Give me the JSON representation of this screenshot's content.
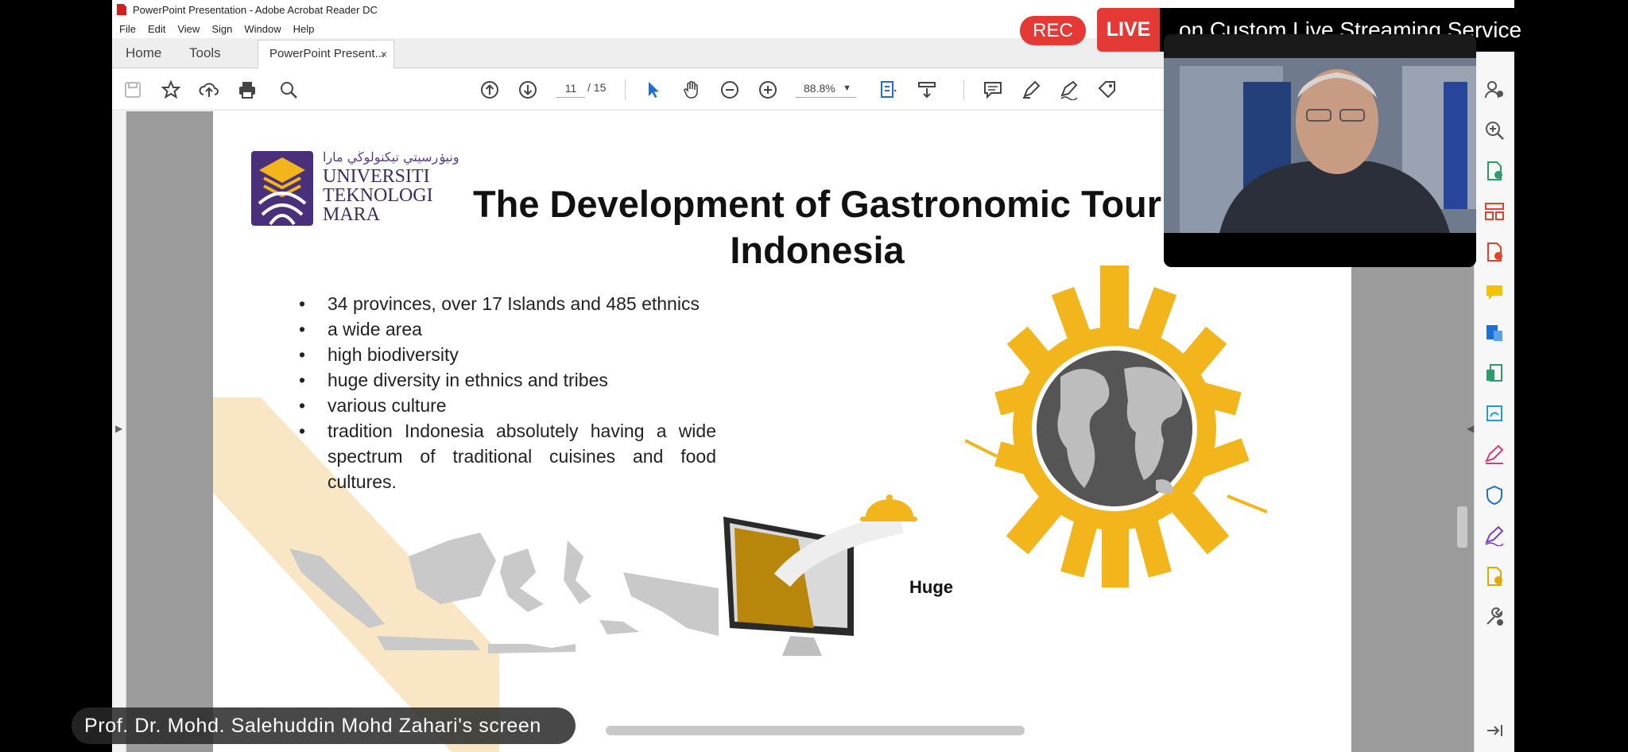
{
  "window": {
    "title": "PowerPoint Presentation - Adobe Acrobat Reader DC"
  },
  "menu": {
    "items": [
      "File",
      "Edit",
      "View",
      "Sign",
      "Window",
      "Help"
    ]
  },
  "tabs": {
    "home": "Home",
    "tools": "Tools",
    "document": "PowerPoint Present...",
    "close": "×"
  },
  "toolbar": {
    "page_current": "11",
    "page_total": "/ 15",
    "zoom": "88.8%",
    "icons": [
      "save-icon",
      "bookmark-star-icon",
      "upload-cloud-icon",
      "print-icon",
      "search-icon",
      "prev-page-icon",
      "next-page-icon",
      "select-cursor-icon",
      "hand-icon",
      "zoom-out-icon",
      "zoom-in-icon",
      "page-fit-icon",
      "scroll-mode-icon",
      "comment-icon",
      "highlight-pen-icon",
      "sign-icon",
      "fill-sign-icon"
    ]
  },
  "right_panel": {
    "icons": [
      "share-user-icon",
      "zoom-icon",
      "export-pdf-icon",
      "organize-pages-icon",
      "create-pdf-icon",
      "comment-icon",
      "edit-pdf-icon",
      "compress-icon",
      "send-sign-icon",
      "fill-sign-icon",
      "protect-icon",
      "sign-pen-icon",
      "more-tools-icon",
      "customize-tools-icon",
      "collapse-panel-icon"
    ],
    "accent": "#e8402b"
  },
  "slide": {
    "logo": {
      "script": "ونيۏرسيتي تيكنولوڬي مارا",
      "line1": "UNIVERSITI",
      "line2": "TEKNOLOGI",
      "line3": "MARA"
    },
    "title_line1": "The Development of Gastronomic Tour",
    "title_line2": "Indonesia",
    "bullets": [
      "34 provinces, over 17 Islands and 485 ethnics",
      "a wide area",
      "high biodiversity",
      "huge diversity in ethnics and tribes",
      "various culture",
      "tradition Indonesia absolutely having a wide spectrum of traditional cuisines and food cultures."
    ],
    "illustration_label": "Huge",
    "colors": {
      "gold": "#f2b51b",
      "globe": "#555555",
      "map": "#c9c9c9",
      "logo_purple": "#4a2f7a"
    }
  },
  "overlay": {
    "rec": "REC",
    "live": "LIVE",
    "stream_label": "on Custom Live Streaming Service",
    "presenter_tag": "Prof. Dr. Mohd. Salehuddin Mohd Zahari's screen"
  }
}
